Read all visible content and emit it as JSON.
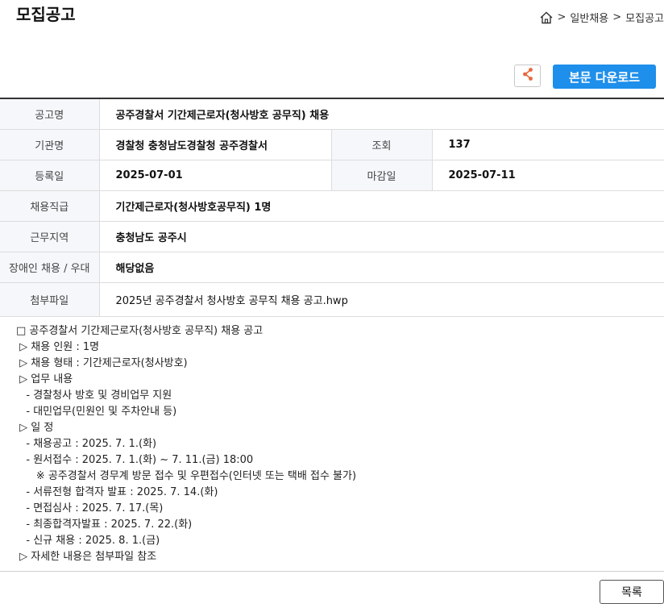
{
  "page_title": "모집공고",
  "breadcrumb": {
    "sep": ">",
    "items": [
      "일반채용",
      "모집공고"
    ]
  },
  "buttons": {
    "download": "본문 다운로드",
    "list": "목록"
  },
  "info": {
    "title_label": "공고명",
    "title_value": "공주경찰서 기간제근로자(청사방호 공무직) 채용",
    "org_label": "기관명",
    "org_value": "경찰청 충청남도경찰청 공주경찰서",
    "views_label": "조회",
    "views_value": "137",
    "reg_label": "등록일",
    "reg_value": "2025-07-01",
    "deadline_label": "마감일",
    "deadline_value": "2025-07-11",
    "position_label": "채용직급",
    "position_value": "기간제근로자(청사방호공무직) 1명",
    "region_label": "근무지역",
    "region_value": "충청남도 공주시",
    "disabled_label": "장애인 채용 / 우대",
    "disabled_value": "해당없음",
    "attach_label": "첨부파일",
    "attach_value": "2025년 공주경찰서 청사방호 공무직 채용 공고.hwp"
  },
  "body_lines": [
    "□ 공주경찰서 기간제근로자(청사방호 공무직) 채용 공고",
    " ▷ 채용 인원 : 1명",
    " ▷ 채용 형태 : 기간제근로자(청사방호)",
    " ▷ 업무 내용",
    "   - 경찰청사 방호 및 경비업무 지원",
    "   - 대민업무(민원인 및 주차안내 등)",
    " ▷ 일 정",
    "   - 채용공고 : 2025. 7. 1.(화)",
    "   - 원서접수 : 2025. 7. 1.(화) ~ 7. 11.(금) 18:00",
    "      ※ 공주경찰서 경무계 방문 접수 및 우편접수(인터넷 또는 택배 접수 불가)",
    "   - 서류전형 합격자 발표 : 2025. 7. 14.(화)",
    "   - 면접심사 : 2025. 7. 17.(목)",
    "   - 최종합격자발표 : 2025. 7. 22.(화)",
    "   - 신규 채용 : 2025. 8. 1.(금)",
    " ▷ 자세한 내용은 첨부파일 참조"
  ]
}
